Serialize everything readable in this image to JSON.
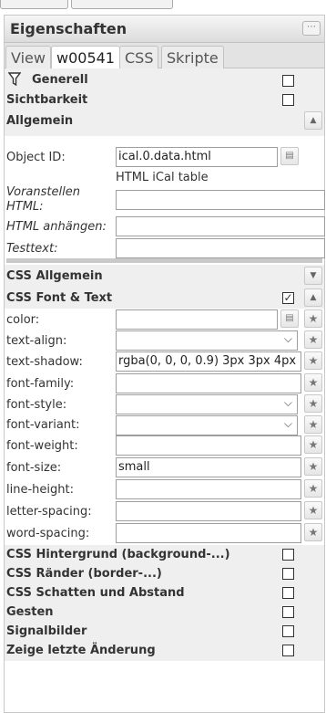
{
  "panel": {
    "title": "Eigenschaften",
    "tabs": [
      "View",
      "w00541",
      "CSS",
      "Skripte"
    ]
  },
  "groups": {
    "generell": "Generell",
    "sichtbarkeit": "Sichtbarkeit",
    "allgemein": "Allgemein",
    "css_allgemein": "CSS Allgemein",
    "css_font_text": "CSS Font & Text",
    "css_hintergrund": "CSS Hintergrund (background-...)",
    "css_raender": "CSS Ränder (border-...)",
    "css_schatten": "CSS Schatten und Abstand",
    "gesten": "Gesten",
    "signalbilder": "Signalbilder",
    "zeige_letzte": "Zeige letzte Änderung"
  },
  "allgemein": {
    "object_id_label": "Object ID:",
    "object_id_value": "ical.0.data.html",
    "object_desc": "HTML iCal table",
    "voranstellen_label": "Voranstellen HTML:",
    "anhaengen_label": "HTML anhängen:",
    "testtext_label": "Testtext:"
  },
  "font_text": {
    "color_label": "color:",
    "text_align_label": "text-align:",
    "text_shadow_label": "text-shadow:",
    "text_shadow_value": "rgba(0, 0, 0, 0.9) 3px 3px 4px",
    "font_family_label": "font-family:",
    "font_style_label": "font-style:",
    "font_variant_label": "font-variant:",
    "font_weight_label": "font-weight:",
    "font_size_label": "font-size:",
    "font_size_value": "small",
    "line_height_label": "line-height:",
    "letter_spacing_label": "letter-spacing:",
    "word_spacing_label": "word-spacing:"
  },
  "icons": {
    "filter": "filter-icon",
    "star": "star-icon",
    "list": "list-icon",
    "menu": "menu-icon"
  }
}
